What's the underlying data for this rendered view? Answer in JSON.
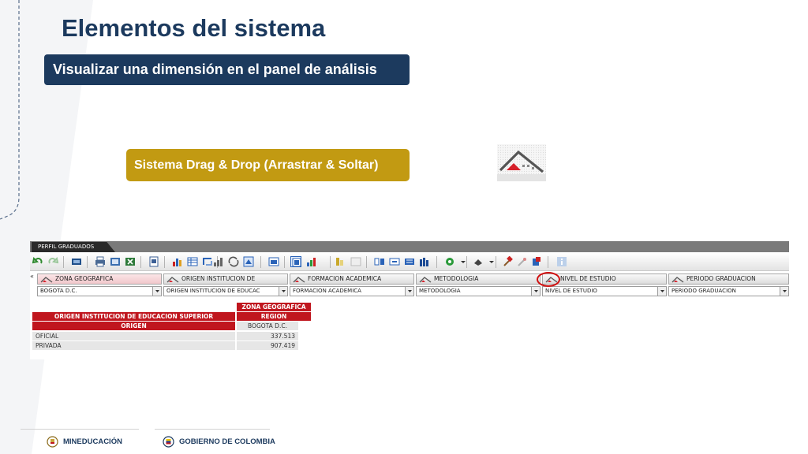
{
  "slide": {
    "title": "Elementos del sistema",
    "subtitle": "Visualizar una dimensión en el panel de análisis",
    "dnd_label": "Sistema Drag & Drop (Arrastrar & Soltar)"
  },
  "colors": {
    "navy": "#1c3a5e",
    "gold": "#c29a12",
    "table_red": "#c0161e",
    "highlight_ring": "#d01010"
  },
  "app": {
    "tab_label": "PERFIL GRADUADOS",
    "collapse_glyph": "«",
    "toolbar_icons": [
      "undo-icon",
      "redo-icon",
      "display-icon",
      "print-icon",
      "export-icon",
      "excel-icon",
      "pdf-icon",
      "chart-icon",
      "table-icon",
      "swap-axes-icon",
      "sort-icon",
      "refresh-icon",
      "view-icon",
      "bar-chart-icon",
      "filter-icon",
      "layout-icon",
      "drill-icon",
      "pivot-icon",
      "hide-icon",
      "settings-icon",
      "tag-icon",
      "hammer-icon",
      "pin-icon",
      "cube-icon",
      "info-icon"
    ],
    "dimensions": [
      {
        "header": "ZONA GEOGRAFICA",
        "selected": "BOGOTA D.C."
      },
      {
        "header": "ORIGEN INSTITUCION DE",
        "selected": "ORIGEN INSTITUCION DE EDUCAC"
      },
      {
        "header": "FORMACION ACADEMICA",
        "selected": "FORMACION ACADEMICA"
      },
      {
        "header": "METODOLOGIA",
        "selected": "METODOLOGIA"
      },
      {
        "header": "NIVEL DE ESTUDIO",
        "selected": "NIVEL DE ESTUDIO"
      },
      {
        "header": "PERIODO GRADUACION",
        "selected": "PERIODO GRADUACION"
      }
    ],
    "table": {
      "col_dim": "ZONA GEOGRAFICA",
      "col_level": "REGION",
      "col_member": "BOGOTA D.C.",
      "row_dim": "ORIGEN INSTITUCION DE EDUCACION SUPERIOR",
      "row_level": "ORIGEN",
      "rows": [
        {
          "label": "OFICIAL",
          "value": "337.513"
        },
        {
          "label": "PRIVADA",
          "value": "907.419"
        }
      ]
    }
  },
  "footer": {
    "left_logo": "MINEDUCACIÓN",
    "right_logo": "GOBIERNO DE COLOMBIA"
  }
}
